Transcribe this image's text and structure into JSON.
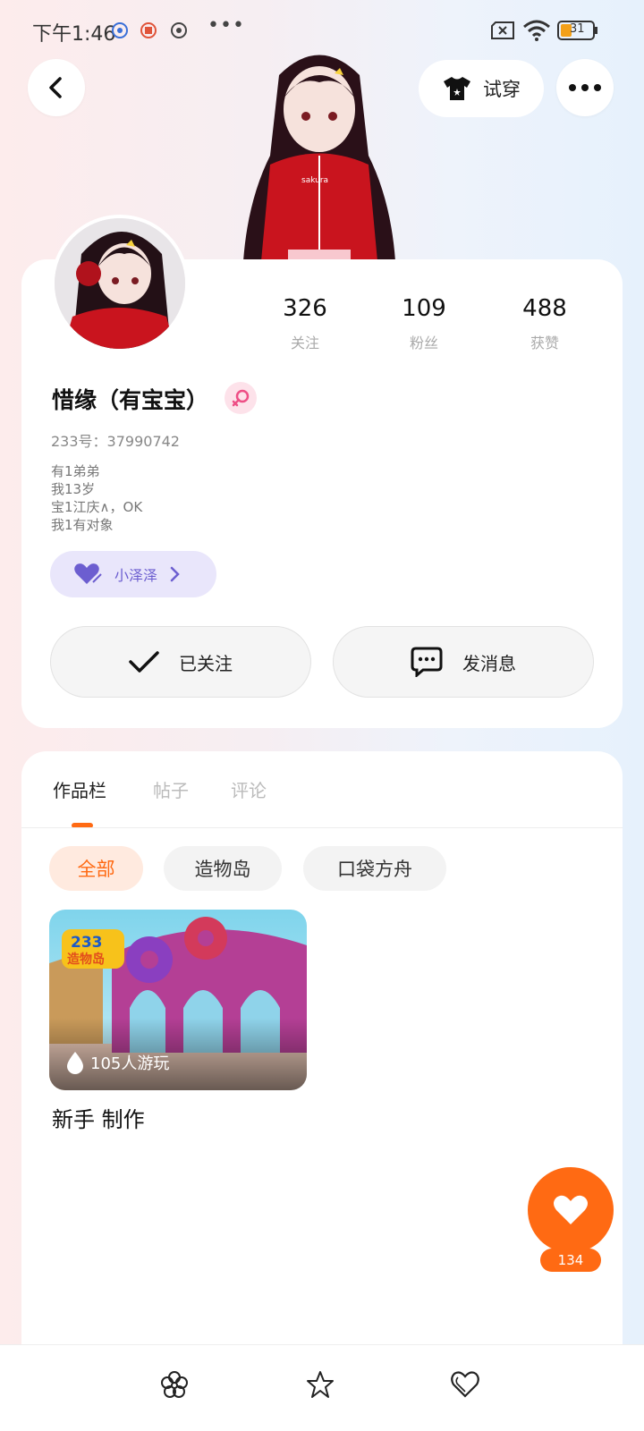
{
  "status_bar": {
    "time": "下午1:46",
    "more": "•••",
    "battery_level": "31"
  },
  "header": {
    "back_icon": "chevron-left-icon",
    "try_on_label": "试穿",
    "more_icon": "more-dots-icon"
  },
  "profile": {
    "stats": [
      {
        "value": "326",
        "label": "关注"
      },
      {
        "value": "109",
        "label": "粉丝"
      },
      {
        "value": "488",
        "label": "获赞"
      }
    ],
    "nickname": "惜缘（有宝宝）",
    "gender": "female",
    "id_line": "233号：37990742",
    "bio": [
      "有1弟弟",
      "我13岁",
      "宝1江庆∧，OK",
      "我1有对象"
    ],
    "fan_group": {
      "label": "小泽泽",
      "icon": "heart-icon",
      "color": "#6c5ed0"
    },
    "follow_button": "已关注",
    "message_button": "发消息"
  },
  "tabs": [
    {
      "label": "作品栏",
      "active": true
    },
    {
      "label": "帖子",
      "active": false
    },
    {
      "label": "评论",
      "active": false
    }
  ],
  "filters": [
    {
      "label": "全部",
      "active": true
    },
    {
      "label": "造物岛",
      "active": false
    },
    {
      "label": "口袋方舟",
      "active": false
    }
  ],
  "works": [
    {
      "thumb_label": "233造物岛",
      "plays": "105人游玩",
      "title": "新手 制作"
    }
  ],
  "like_fab": {
    "count": "134",
    "icon": "heart-icon"
  },
  "bottom_bar": {
    "icons": [
      "flower-icon",
      "star-icon",
      "heart-outline-icon"
    ]
  },
  "colors": {
    "accent": "#ff6a13",
    "fan_pill_bg": "#e9e6fb",
    "gender_badge": "#fde2ea"
  }
}
